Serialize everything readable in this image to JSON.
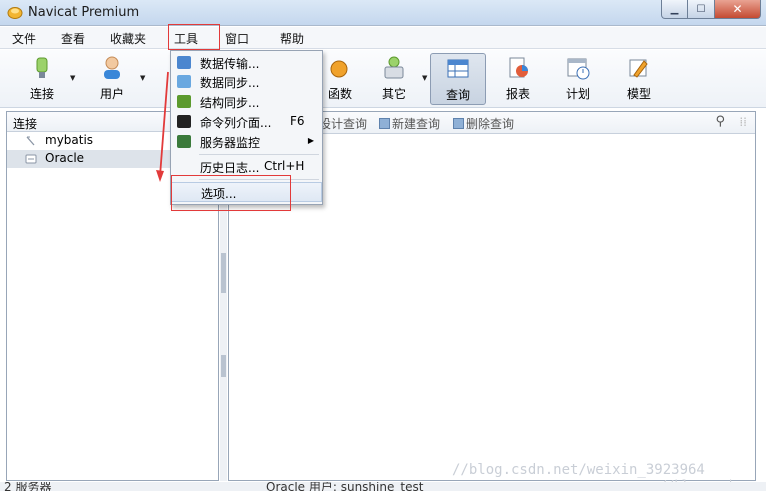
{
  "window": {
    "title": "Navicat Premium"
  },
  "menubar": {
    "items": [
      "文件",
      "查看",
      "收藏夹",
      "工具",
      "窗口",
      "帮助"
    ]
  },
  "toolbar": {
    "connect": "连接",
    "user": "用户",
    "function": "函数",
    "other": "其它",
    "query": "查询",
    "report": "报表",
    "schedule": "计划",
    "model": "模型"
  },
  "leftpanel": {
    "header": "连接",
    "connections": [
      "mybatis",
      "Oracle"
    ]
  },
  "subtoolbar": {
    "design": "设计查询",
    "new": "新建查询",
    "delete": "删除查询"
  },
  "dropdown": {
    "items": [
      {
        "label": "数据传输...",
        "shortcut": ""
      },
      {
        "label": "数据同步...",
        "shortcut": ""
      },
      {
        "label": "结构同步...",
        "shortcut": ""
      },
      {
        "label": "命令列介面...",
        "shortcut": "F6"
      },
      {
        "label": "服务器监控",
        "shortcut": ""
      },
      {
        "label": "历史日志...",
        "shortcut": "Ctrl+H"
      },
      {
        "label": "选项...",
        "shortcut": ""
      }
    ]
  },
  "statusbar": {
    "servers": "2 服务器",
    "info": "Oracle   用户: sunshine_test"
  },
  "watermark": "//blog.csdn.net/weixin_3923964",
  "watermark2": "//blog.csdn.",
  "colors": {
    "annotation_red": "#e23a3a",
    "selection": "#dde3ea"
  }
}
